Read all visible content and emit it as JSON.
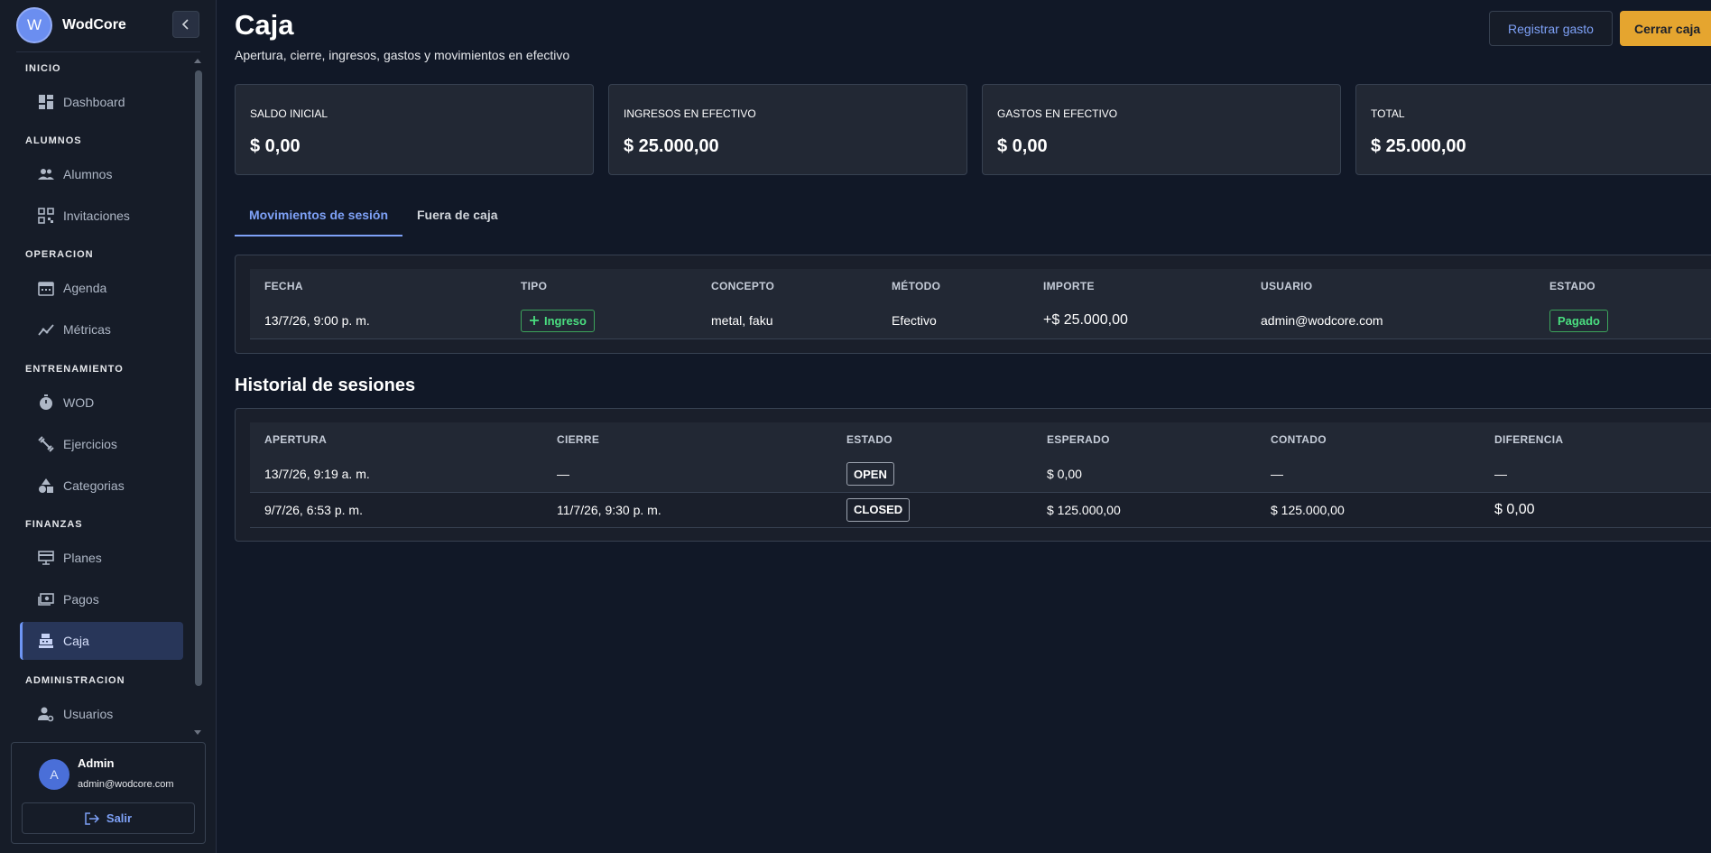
{
  "brand": {
    "initial": "W",
    "name": "WodCore"
  },
  "sidebar": {
    "sections": [
      {
        "label": "INICIO",
        "items": [
          {
            "label": "Dashboard",
            "icon": "dashboard-icon"
          }
        ]
      },
      {
        "label": "ALUMNOS",
        "items": [
          {
            "label": "Alumnos",
            "icon": "people-icon"
          },
          {
            "label": "Invitaciones",
            "icon": "qr-code-icon"
          }
        ]
      },
      {
        "label": "OPERACION",
        "items": [
          {
            "label": "Agenda",
            "icon": "calendar-icon"
          },
          {
            "label": "Métricas",
            "icon": "metrics-icon"
          }
        ]
      },
      {
        "label": "ENTRENAMIENTO",
        "items": [
          {
            "label": "WOD",
            "icon": "timer-icon"
          },
          {
            "label": "Ejercicios",
            "icon": "dumbbell-icon"
          },
          {
            "label": "Categorias",
            "icon": "shapes-icon"
          }
        ]
      },
      {
        "label": "FINANZAS",
        "items": [
          {
            "label": "Planes",
            "icon": "plans-icon"
          },
          {
            "label": "Pagos",
            "icon": "payments-icon"
          },
          {
            "label": "Caja",
            "icon": "cash-register-icon",
            "active": true
          }
        ]
      },
      {
        "label": "ADMINISTRACION",
        "items": [
          {
            "label": "Usuarios",
            "icon": "user-settings-icon"
          }
        ]
      }
    ]
  },
  "user": {
    "initial": "A",
    "name": "Admin",
    "email": "admin@wodcore.com",
    "logout_label": "Salir"
  },
  "header": {
    "title": "Caja",
    "subtitle": "Apertura, cierre, ingresos, gastos y movimientos en efectivo",
    "register_expense_label": "Registrar gasto",
    "close_register_label": "Cerrar caja"
  },
  "stats": [
    {
      "label": "SALDO INICIAL",
      "value": "$ 0,00"
    },
    {
      "label": "INGRESOS EN EFECTIVO",
      "value": "$ 25.000,00"
    },
    {
      "label": "GASTOS EN EFECTIVO",
      "value": "$ 0,00"
    },
    {
      "label": "TOTAL",
      "value": "$ 25.000,00"
    }
  ],
  "tabs": [
    {
      "label": "Movimientos de sesión",
      "active": true
    },
    {
      "label": "Fuera de caja",
      "active": false
    }
  ],
  "movements": {
    "columns": [
      "FECHA",
      "TIPO",
      "CONCEPTO",
      "MÉTODO",
      "IMPORTE",
      "USUARIO",
      "ESTADO"
    ],
    "rows": [
      {
        "fecha": "13/7/26, 9:00 p. m.",
        "tipo": "Ingreso",
        "concepto": "metal, faku",
        "metodo": "Efectivo",
        "importe": "+$ 25.000,00",
        "usuario": "admin@wodcore.com",
        "estado": "Pagado"
      }
    ]
  },
  "history": {
    "title": "Historial de sesiones",
    "columns": [
      "APERTURA",
      "CIERRE",
      "ESTADO",
      "ESPERADO",
      "CONTADO",
      "DIFERENCIA"
    ],
    "rows": [
      {
        "apertura": "13/7/26, 9:19 a. m.",
        "cierre": "—",
        "estado": "OPEN",
        "esperado": "$ 0,00",
        "contado": "—",
        "diferencia": "—"
      },
      {
        "apertura": "9/7/26, 6:53 p. m.",
        "cierre": "11/7/26, 9:30 p. m.",
        "estado": "CLOSED",
        "esperado": "$ 125.000,00",
        "contado": "$ 125.000,00",
        "diferencia": "$ 0,00"
      }
    ]
  },
  "colors": {
    "accent": "#7ea1f7",
    "primary_button": "#e5a52f",
    "success": "#4ade80",
    "background": "#111827"
  }
}
